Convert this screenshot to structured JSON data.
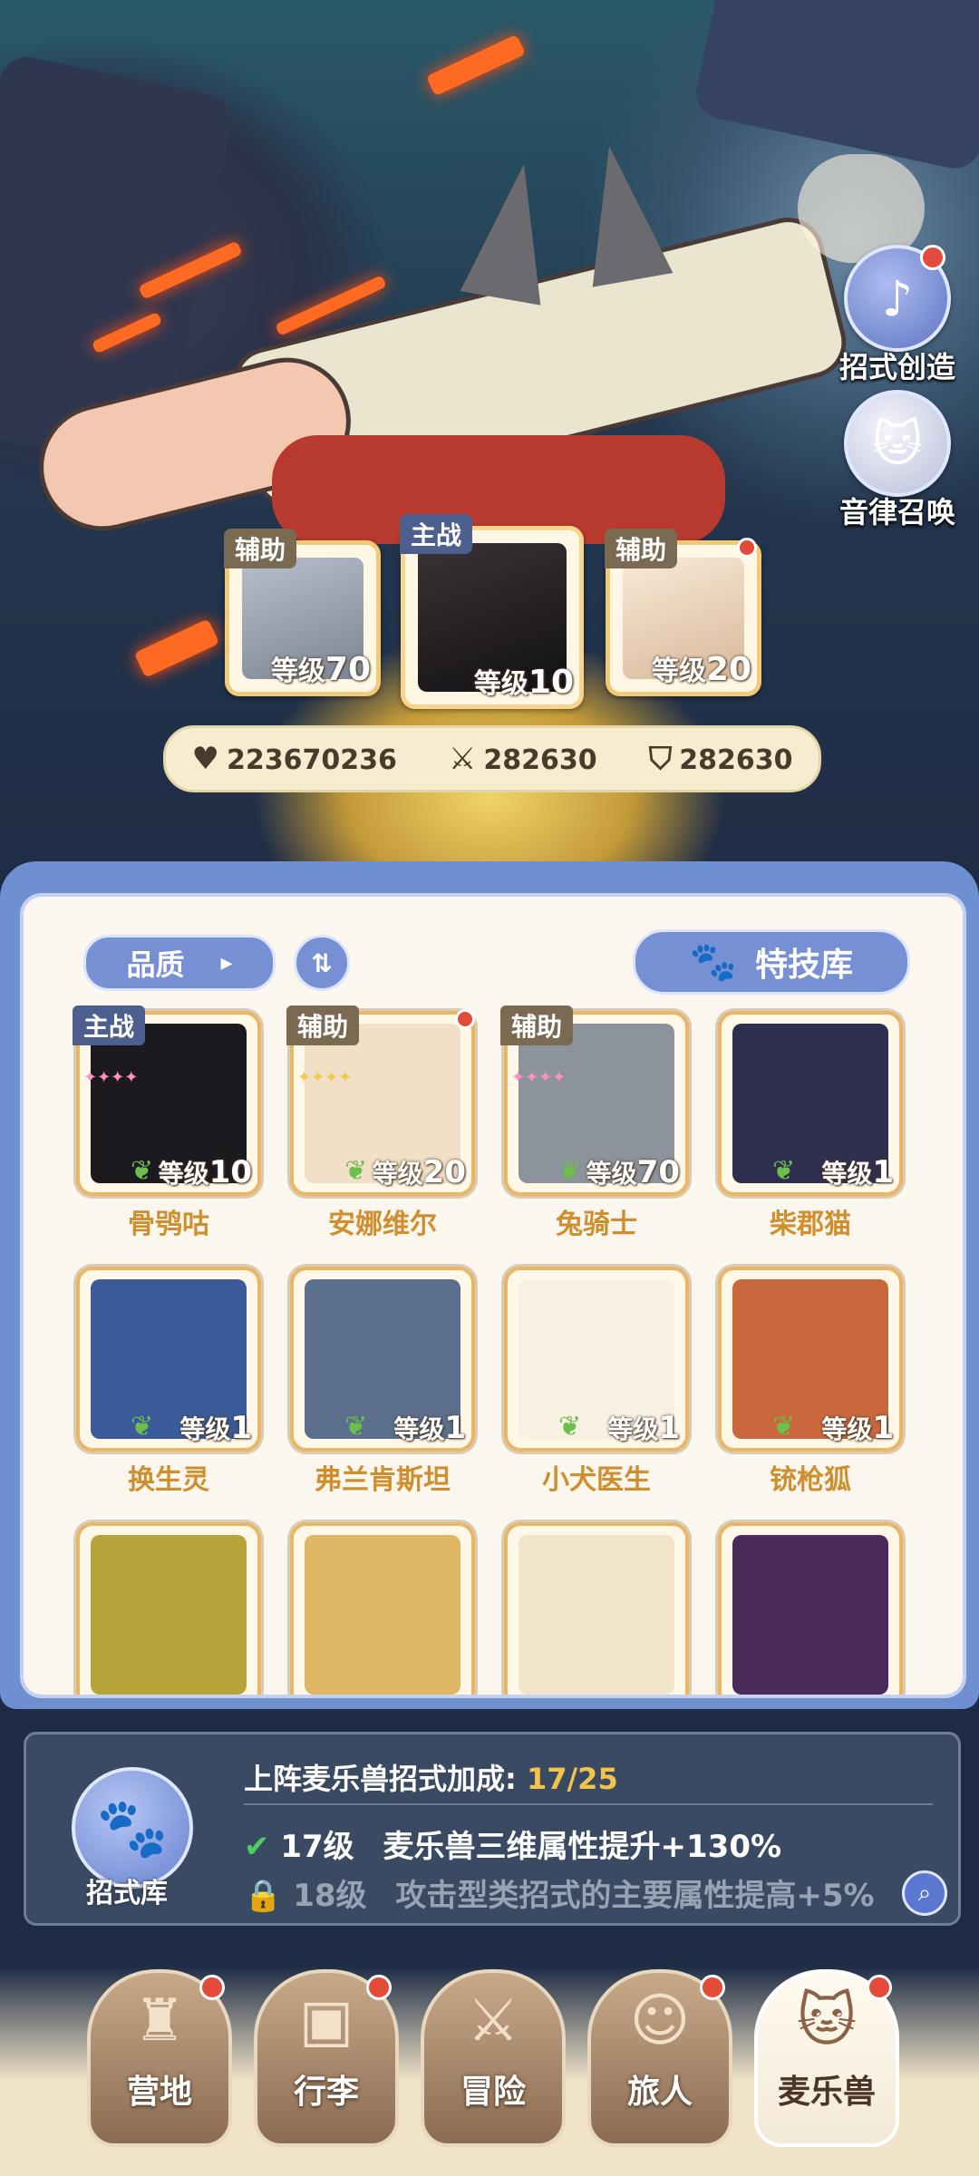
{
  "side_buttons": [
    {
      "label": "招式创造",
      "icon": "move-create-icon",
      "has_dot": true
    },
    {
      "label": "音律召唤",
      "icon": "summon-cat-icon",
      "has_dot": false
    }
  ],
  "team": [
    {
      "role": "辅助",
      "level_prefix": "等级",
      "level": "70",
      "name_hint": "rabbit-knight"
    },
    {
      "role": "主战",
      "level_prefix": "等级",
      "level": "10",
      "name_hint": "crow"
    },
    {
      "role": "辅助",
      "level_prefix": "等级",
      "level": "20",
      "name_hint": "sheep"
    }
  ],
  "stats": {
    "hp": "223670236",
    "attack": "282630",
    "defense": "282630"
  },
  "filter": {
    "quality_label": "品质",
    "skill_library_label": "特技库"
  },
  "grid": [
    {
      "name": "骨鸮咕",
      "tag": "主战",
      "level_prefix": "等级",
      "level": "10",
      "color": "#1d1a1f"
    },
    {
      "name": "安娜维尔",
      "tag": "辅助",
      "level_prefix": "等级",
      "level": "20",
      "color": "#f1dfc8"
    },
    {
      "name": "兔骑士",
      "tag": "辅助",
      "level_prefix": "等级",
      "level": "70",
      "color": "#8c939c"
    },
    {
      "name": "柴郡猫",
      "tag": "",
      "level_prefix": "等级",
      "level": "1",
      "color": "#2e2f4f"
    },
    {
      "name": "换生灵",
      "tag": "",
      "level_prefix": "等级",
      "level": "1",
      "color": "#3b5a9a"
    },
    {
      "name": "弗兰肯斯坦",
      "tag": "",
      "level_prefix": "等级",
      "level": "1",
      "color": "#5b6f8d"
    },
    {
      "name": "小犬医生",
      "tag": "",
      "level_prefix": "等级",
      "level": "1",
      "color": "#f7f1e4"
    },
    {
      "name": "铳枪狐",
      "tag": "",
      "level_prefix": "等级",
      "level": "1",
      "color": "#c8683c"
    },
    {
      "name": "",
      "tag": "",
      "level_prefix": "",
      "level": "",
      "color": "#b6a33a"
    },
    {
      "name": "",
      "tag": "",
      "level_prefix": "",
      "level": "",
      "color": "#e0b865"
    },
    {
      "name": "",
      "tag": "",
      "level_prefix": "",
      "level": "",
      "color": "#f2e4c8"
    },
    {
      "name": "",
      "tag": "",
      "level_prefix": "",
      "level": "",
      "color": "#4a2b5c"
    }
  ],
  "bonus": {
    "library_label": "招式库",
    "title": "上阵麦乐兽招式加成:",
    "progress": "17/25",
    "rows": [
      {
        "level": "17级",
        "text": "麦乐兽三维属性提升+130%",
        "unlocked": true
      },
      {
        "level": "18级",
        "text": "攻击型类招式的主要属性提高+5%",
        "unlocked": false
      }
    ]
  },
  "nav": [
    {
      "label": "营地",
      "icon": "castle-icon",
      "dot": true,
      "active": false
    },
    {
      "label": "行李",
      "icon": "backpack-icon",
      "dot": true,
      "active": false
    },
    {
      "label": "冒险",
      "icon": "crossed-swords-icon",
      "dot": false,
      "active": false
    },
    {
      "label": "旅人",
      "icon": "traveler-icon",
      "dot": true,
      "active": false
    },
    {
      "label": "麦乐兽",
      "icon": "cat-head-icon",
      "dot": true,
      "active": true
    }
  ]
}
